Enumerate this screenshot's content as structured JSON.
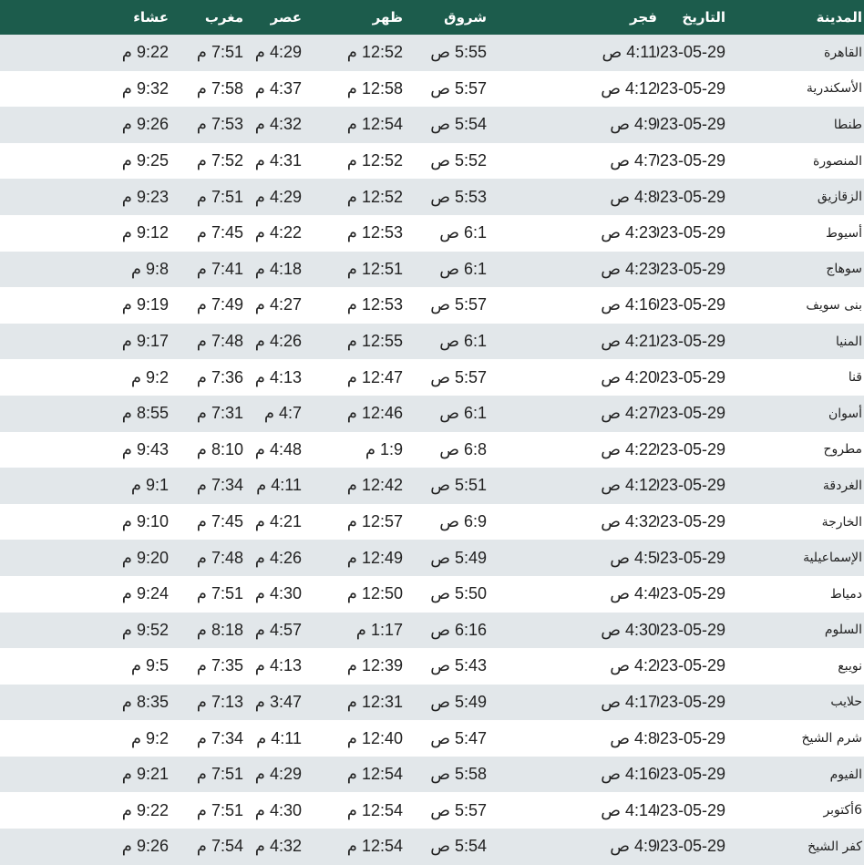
{
  "headers": {
    "city": "المدينة",
    "date": "التاريخ",
    "fajr": "فجر",
    "sunrise": "شروق",
    "dhuhr": "ظهر",
    "asr": "عصر",
    "maghrib": "مغرب",
    "isha": "عشاء"
  },
  "colors": {
    "header_bg": "#1c5c4c",
    "header_text": "#ffffff",
    "row_stripe": "#e2e7ea",
    "row_plain": "#ffffff",
    "cell_text": "#222222"
  },
  "rows": [
    {
      "city": "القاهرة",
      "date": "2023-05-29",
      "fajr": "4:11 ص",
      "sunrise": "5:55 ص",
      "dhuhr": "12:52 م",
      "asr": "4:29 م",
      "maghrib": "7:51 م",
      "isha": "9:22 م"
    },
    {
      "city": "الأسكندرية",
      "date": "2023-05-29",
      "fajr": "4:12 ص",
      "sunrise": "5:57 ص",
      "dhuhr": "12:58 م",
      "asr": "4:37 م",
      "maghrib": "7:58 م",
      "isha": "9:32 م"
    },
    {
      "city": "طنطا",
      "date": "2023-05-29",
      "fajr": "4:9 ص",
      "sunrise": "5:54 ص",
      "dhuhr": "12:54 م",
      "asr": "4:32 م",
      "maghrib": "7:53 م",
      "isha": "9:26 م"
    },
    {
      "city": "المنصورة",
      "date": "2023-05-29",
      "fajr": "4:7 ص",
      "sunrise": "5:52 ص",
      "dhuhr": "12:52 م",
      "asr": "4:31 م",
      "maghrib": "7:52 م",
      "isha": "9:25 م"
    },
    {
      "city": "الزقازيق",
      "date": "2023-05-29",
      "fajr": "4:8 ص",
      "sunrise": "5:53 ص",
      "dhuhr": "12:52 م",
      "asr": "4:29 م",
      "maghrib": "7:51 م",
      "isha": "9:23 م"
    },
    {
      "city": "أسيوط",
      "date": "2023-05-29",
      "fajr": "4:23 ص",
      "sunrise": "6:1 ص",
      "dhuhr": "12:53 م",
      "asr": "4:22 م",
      "maghrib": "7:45 م",
      "isha": "9:12 م"
    },
    {
      "city": "سوهاج",
      "date": "2023-05-29",
      "fajr": "4:23 ص",
      "sunrise": "6:1 ص",
      "dhuhr": "12:51 م",
      "asr": "4:18 م",
      "maghrib": "7:41 م",
      "isha": "9:8 م"
    },
    {
      "city": "بنى سويف",
      "date": "2023-05-29",
      "fajr": "4:16 ص",
      "sunrise": "5:57 ص",
      "dhuhr": "12:53 م",
      "asr": "4:27 م",
      "maghrib": "7:49 م",
      "isha": "9:19 م"
    },
    {
      "city": "المنيا",
      "date": "2023-05-29",
      "fajr": "4:21 ص",
      "sunrise": "6:1 ص",
      "dhuhr": "12:55 م",
      "asr": "4:26 م",
      "maghrib": "7:48 م",
      "isha": "9:17 م"
    },
    {
      "city": "قنا",
      "date": "2023-05-29",
      "fajr": "4:20 ص",
      "sunrise": "5:57 ص",
      "dhuhr": "12:47 م",
      "asr": "4:13 م",
      "maghrib": "7:36 م",
      "isha": "9:2 م"
    },
    {
      "city": "أسوان",
      "date": "2023-05-29",
      "fajr": "4:27 ص",
      "sunrise": "6:1 ص",
      "dhuhr": "12:46 م",
      "asr": "4:7 م",
      "maghrib": "7:31 م",
      "isha": "8:55 م"
    },
    {
      "city": "مطروح",
      "date": "2023-05-29",
      "fajr": "4:22 ص",
      "sunrise": "6:8 ص",
      "dhuhr": "1:9 م",
      "asr": "4:48 م",
      "maghrib": "8:10 م",
      "isha": "9:43 م"
    },
    {
      "city": "الغردقة",
      "date": "2023-05-29",
      "fajr": "4:12 ص",
      "sunrise": "5:51 ص",
      "dhuhr": "12:42 م",
      "asr": "4:11 م",
      "maghrib": "7:34 م",
      "isha": "9:1 م"
    },
    {
      "city": "الخارجة",
      "date": "2023-05-29",
      "fajr": "4:32 ص",
      "sunrise": "6:9 ص",
      "dhuhr": "12:57 م",
      "asr": "4:21 م",
      "maghrib": "7:45 م",
      "isha": "9:10 م"
    },
    {
      "city": "الإسماعيلية",
      "date": "2023-05-29",
      "fajr": "4:5 ص",
      "sunrise": "5:49 ص",
      "dhuhr": "12:49 م",
      "asr": "4:26 م",
      "maghrib": "7:48 م",
      "isha": "9:20 م"
    },
    {
      "city": "دمياط",
      "date": "2023-05-29",
      "fajr": "4:4 ص",
      "sunrise": "5:50 ص",
      "dhuhr": "12:50 م",
      "asr": "4:30 م",
      "maghrib": "7:51 م",
      "isha": "9:24 م"
    },
    {
      "city": "السلوم",
      "date": "2023-05-29",
      "fajr": "4:30 ص",
      "sunrise": "6:16 ص",
      "dhuhr": "1:17 م",
      "asr": "4:57 م",
      "maghrib": "8:18 م",
      "isha": "9:52 م"
    },
    {
      "city": "نويبع",
      "date": "2023-05-29",
      "fajr": "4:2 ص",
      "sunrise": "5:43 ص",
      "dhuhr": "12:39 م",
      "asr": "4:13 م",
      "maghrib": "7:35 م",
      "isha": "9:5 م"
    },
    {
      "city": "حلايب",
      "date": "2023-05-29",
      "fajr": "4:17 ص",
      "sunrise": "5:49 ص",
      "dhuhr": "12:31 م",
      "asr": "3:47 م",
      "maghrib": "7:13 م",
      "isha": "8:35 م"
    },
    {
      "city": "شرم الشيخ",
      "date": "2023-05-29",
      "fajr": "4:8 ص",
      "sunrise": "5:47 ص",
      "dhuhr": "12:40 م",
      "asr": "4:11 م",
      "maghrib": "7:34 م",
      "isha": "9:2 م"
    },
    {
      "city": "الفيوم",
      "date": "2023-05-29",
      "fajr": "4:16 ص",
      "sunrise": "5:58 ص",
      "dhuhr": "12:54 م",
      "asr": "4:29 م",
      "maghrib": "7:51 م",
      "isha": "9:21 م"
    },
    {
      "city": "6أكتوبر",
      "date": "2023-05-29",
      "fajr": "4:14 ص",
      "sunrise": "5:57 ص",
      "dhuhr": "12:54 م",
      "asr": "4:30 م",
      "maghrib": "7:51 م",
      "isha": "9:22 م"
    },
    {
      "city": "كفر الشيخ",
      "date": "2023-05-29",
      "fajr": "4:9 ص",
      "sunrise": "5:54 ص",
      "dhuhr": "12:54 م",
      "asr": "4:32 م",
      "maghrib": "7:54 م",
      "isha": "9:26 م"
    }
  ]
}
